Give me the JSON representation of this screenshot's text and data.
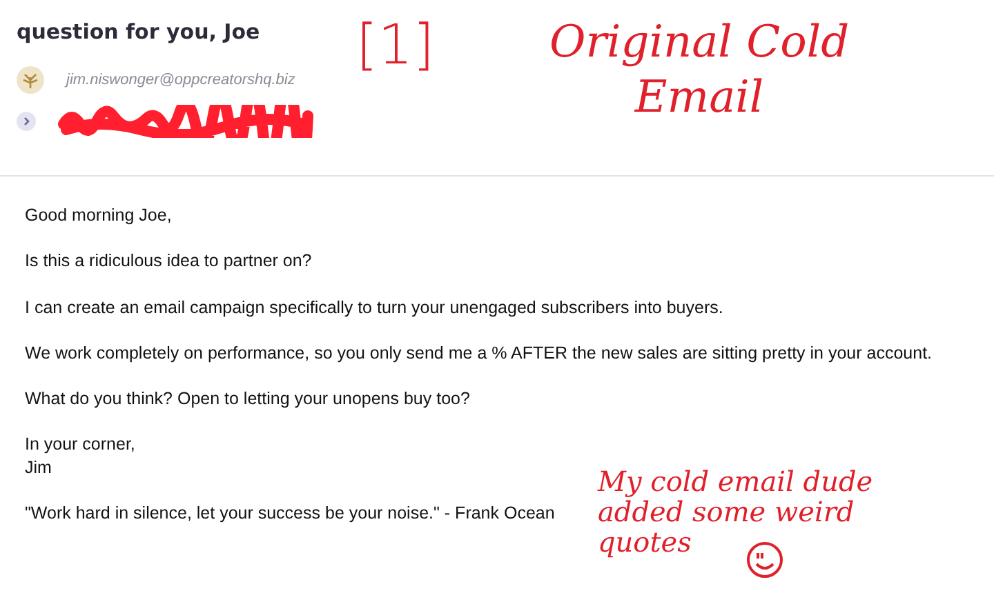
{
  "email": {
    "subject": "question for you, Joe",
    "sender": {
      "address": "jim.niswonger@oppcreatorshq.biz"
    },
    "recipient": {
      "kind": "redacted"
    },
    "body": [
      {
        "text": "Good morning Joe,"
      },
      {
        "text": "Is this a ridiculous idea to partner on?"
      },
      {
        "text": "I can create an email campaign specifically to turn your unengaged subscribers into buyers."
      },
      {
        "text": "We work completely on performance, so you only send me a % AFTER the new sales are sitting pretty in your account."
      },
      {
        "text": "What do you think? Open to letting your unopens buy too?"
      },
      {
        "text": "In your corner,\nJim"
      },
      {
        "text": "\"Work hard in silence, let your success be your noise.\" - Frank Ocean"
      }
    ]
  },
  "annotations": [
    {
      "kind": "number",
      "text": "[1]"
    },
    {
      "kind": "title",
      "text": "Original Cold\nEmail"
    },
    {
      "kind": "note",
      "text": "My cold email dude\nadded some weird\nquotes",
      "smiley": true
    }
  ]
}
